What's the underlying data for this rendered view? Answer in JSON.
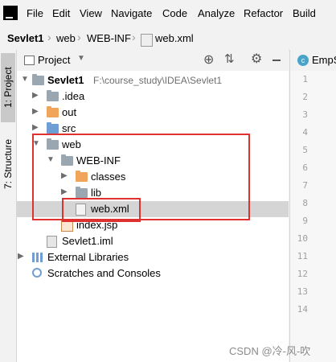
{
  "menu": [
    "File",
    "Edit",
    "View",
    "Navigate",
    "Code",
    "Analyze",
    "Refactor",
    "Build"
  ],
  "breadcrumb": [
    "Sevlet1",
    "web",
    "WEB-INF",
    "web.xml"
  ],
  "toolstrip": {
    "project": "1: Project",
    "structure": "7: Structure"
  },
  "panel": {
    "title": "Project"
  },
  "tree": {
    "root": {
      "name": "Sevlet1",
      "path": "F:\\course_study\\IDEA\\Sevlet1"
    },
    "idea": ".idea",
    "out": "out",
    "src": "src",
    "web": "web",
    "webinf": "WEB-INF",
    "classes": "classes",
    "lib": "lib",
    "webxml": "web.xml",
    "indexjsp": "index.jsp",
    "iml": "Sevlet1.iml",
    "external": "External Libraries",
    "scratches": "Scratches and Consoles"
  },
  "editor": {
    "tab": "EmpS",
    "lines": [
      "1",
      "2",
      "3",
      "4",
      "5",
      "6",
      "7",
      "8",
      "9",
      "10",
      "11",
      "12",
      "13",
      "14"
    ]
  },
  "watermark": "CSDN @冷-风-吹",
  "colors": {
    "highlight_box": "#e03131",
    "selection": "#d5d5d5",
    "root_bold": "#000000"
  }
}
